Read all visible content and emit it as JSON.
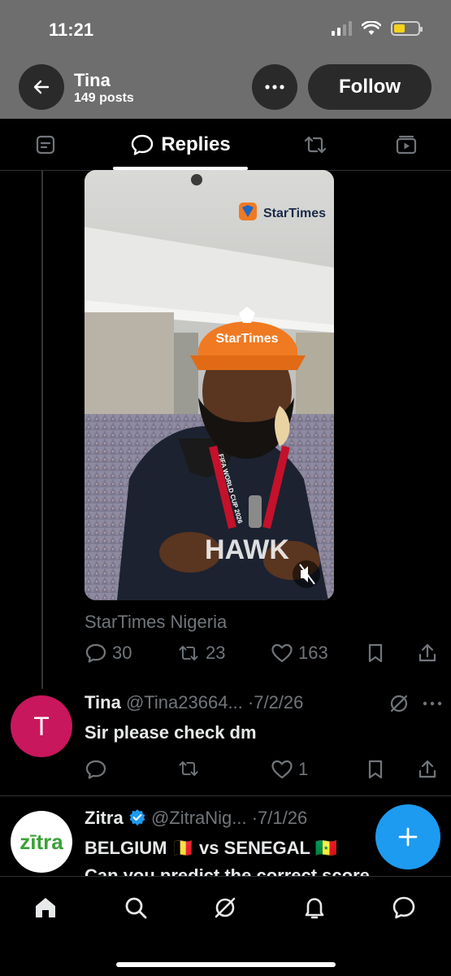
{
  "status_bar": {
    "time": "11:21",
    "icons": [
      "signal-icon",
      "wifi-icon",
      "battery-icon"
    ]
  },
  "header": {
    "name": "Tina",
    "posts": "149 posts",
    "follow_label": "Follow",
    "icons": [
      "back-arrow-icon",
      "more-icon"
    ]
  },
  "tabs": [
    {
      "icon": "posts-icon",
      "label": ""
    },
    {
      "icon": "reply-icon",
      "label": "Replies"
    },
    {
      "icon": "repost-icon",
      "label": ""
    },
    {
      "icon": "video-icon",
      "label": ""
    }
  ],
  "video_post": {
    "overlay_brand": "StarTimes",
    "cap_text": "StarTimes",
    "lanyard_text": "FIFA WORLD CUP 2026",
    "source": "StarTimes Nigeria",
    "replies": "30",
    "reposts": "23",
    "likes": "163",
    "mute_icon": "muted-speaker-icon"
  },
  "reply_post": {
    "avatar_letter": "T",
    "author": "Tina",
    "handle_date": "@Tina23664... ·7/2/26",
    "text": "Sir please check dm",
    "replies": "",
    "reposts": "",
    "likes": "1"
  },
  "next_post": {
    "avatar_text": "zītra",
    "author": "Zitra",
    "handle_date": "@ZitraNig... ·7/1/26",
    "line1": "BELGIUM 🇧🇪 vs SENEGAL 🇸🇳",
    "line2": "Can you predict the correct score"
  },
  "fab": {
    "icon": "compose-plus-icon"
  },
  "bottom_nav": [
    "home-icon",
    "search-icon",
    "grok-icon",
    "notifications-icon",
    "messages-icon"
  ],
  "colors": {
    "accent": "#1d9bf0",
    "avatar_t": "#c8175d",
    "cap_orange": "#f07a22"
  }
}
